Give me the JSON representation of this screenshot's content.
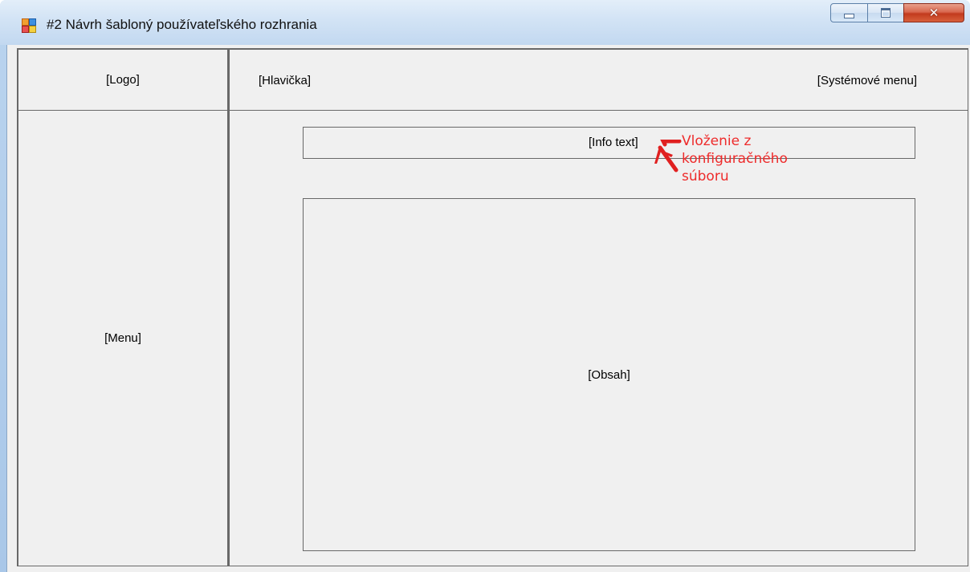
{
  "window": {
    "title": "#2 Návrh šabloný používateľského rozhrania",
    "app_icon": "app-window-icon",
    "controls": {
      "minimize": "minimize-icon",
      "maximize": "maximize-icon",
      "close": "close-icon"
    }
  },
  "layout": {
    "logo": "[Logo]",
    "header": "[Hlavička]",
    "system_menu": "[Systémové menu]",
    "menu": "[Menu]",
    "info_text": "[Info text]",
    "content": "[Obsah]"
  },
  "annotation": {
    "line1": "Vloženie z",
    "line2": "konfiguračného",
    "line3": "súboru",
    "color": "#ee2b2b",
    "icon": "red-arrow-icon"
  }
}
